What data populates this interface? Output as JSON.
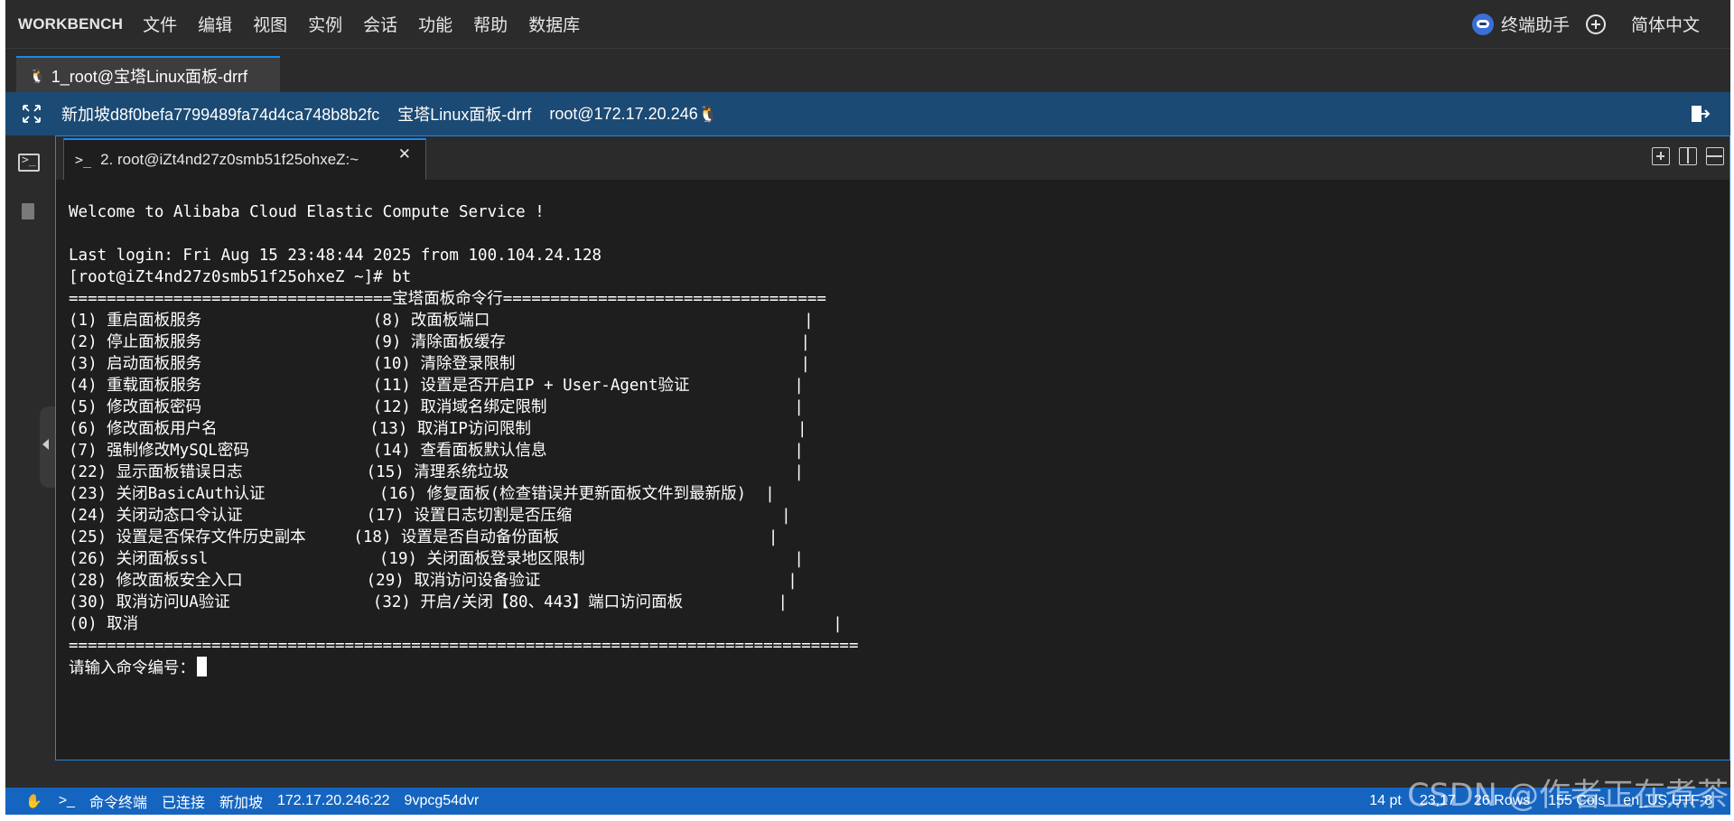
{
  "app": {
    "brand": "WORKBENCH"
  },
  "menu": [
    "文件",
    "编辑",
    "视图",
    "实例",
    "会话",
    "功能",
    "帮助",
    "数据库"
  ],
  "menubar_right": {
    "assistant": "终端助手",
    "language": "简体中文"
  },
  "session_tab": {
    "label": "1_root@宝塔Linux面板-drrf",
    "icon": "linux-penguin-icon"
  },
  "info_bar": {
    "region_id": "新加坡d8f0befa7799489fa74d4ca748b8b2fc",
    "instance_name": "宝塔Linux面板-drrf",
    "user_host": "root@172.17.20.246🐧"
  },
  "terminal_tab": {
    "label": "2. root@iZt4nd27z0smb51f25ohxeZ:~"
  },
  "terminal_lines": [
    "",
    "Welcome to Alibaba Cloud Elastic Compute Service !",
    "",
    "Last login: Fri Aug 15 23:48:44 2025 from 100.104.24.128",
    "[root@iZt4nd27z0smb51f25ohxeZ ~]# bt",
    "==================================宝塔面板命令行==================================",
    "(1) 重启面板服务                  (8) 改面板端口                                 |",
    "(2) 停止面板服务                  (9) 清除面板缓存                               |",
    "(3) 启动面板服务                  (10) 清除登录限制                              |",
    "(4) 重载面板服务                  (11) 设置是否开启IP + User-Agent验证           |",
    "(5) 修改面板密码                  (12) 取消域名绑定限制                          |",
    "(6) 修改面板用户名                (13) 取消IP访问限制                            |",
    "(7) 强制修改MySQL密码             (14) 查看面板默认信息                          |",
    "(22) 显示面板错误日志             (15) 清理系统垃圾                              |",
    "(23) 关闭BasicAuth认证            (16) 修复面板(检查错误并更新面板文件到最新版)  |",
    "(24) 关闭动态口令认证             (17) 设置日志切割是否压缩                      |",
    "(25) 设置是否保存文件历史副本     (18) 设置是否自动备份面板                      |",
    "(26) 关闭面板ssl                  (19) 关闭面板登录地区限制                      |",
    "(28) 修改面板安全入口             (29) 取消访问设备验证                          |",
    "(30) 取消访问UA验证               (32) 开启/关闭【80、443】端口访问面板          |",
    "(0) 取消                                                                         |",
    "==================================================================================="
  ],
  "terminal_prompt": "请输入命令编号：",
  "status_bar": {
    "mode": "命令终端",
    "connection": "已连接",
    "region": "新加坡",
    "address": "172.17.20.246:22",
    "session_id": "9vpcg54dvr",
    "font_size": "14 pt",
    "cursor_pos": "23,17",
    "rows": "26 Rows",
    "cols": "155 Cols",
    "locale": "en_US.UTF-8"
  },
  "watermark": "CSDN @作者正在煮茶",
  "colors": {
    "menubar_bg": "#2b2b2b",
    "infobar_bg": "#1b4a74",
    "terminal_bg": "#1e1e1e",
    "statusbar_bg": "#1565c0",
    "accent": "#1e88e5"
  }
}
